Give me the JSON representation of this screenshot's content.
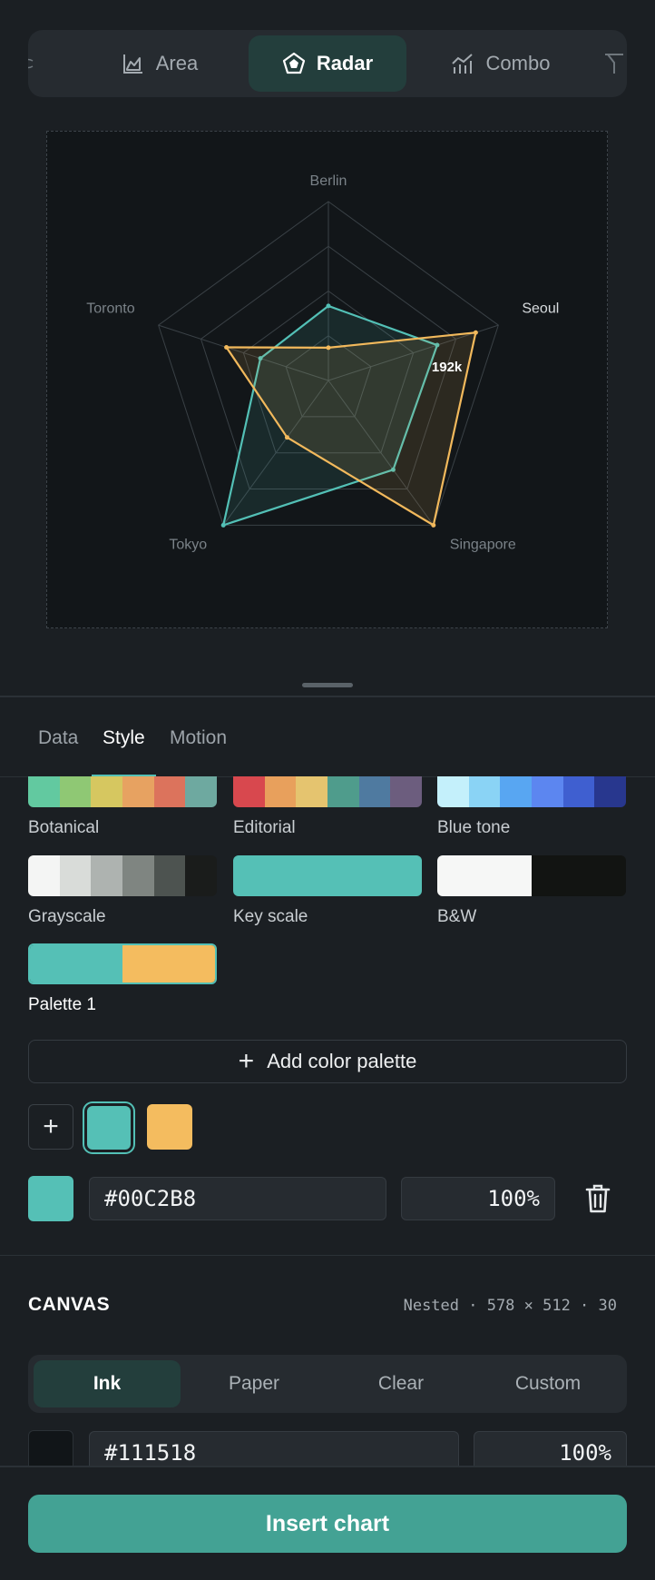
{
  "chart_types": [
    {
      "label": "Area",
      "icon": "area-chart-icon",
      "active": false
    },
    {
      "label": "Radar",
      "icon": "radar-chart-icon",
      "active": true
    },
    {
      "label": "Combo",
      "icon": "combo-chart-icon",
      "active": false
    }
  ],
  "chart_data": {
    "type": "radar",
    "categories": [
      "Berlin",
      "Seoul",
      "Singapore",
      "Tokyo",
      "Toronto"
    ],
    "value_max": 300,
    "series": [
      {
        "color": "#53c0b6",
        "values": [
          125,
          192,
          185,
          300,
          120
        ]
      },
      {
        "color": "#f2b95c",
        "values": [
          55,
          260,
          300,
          118,
          180
        ]
      }
    ],
    "annotation": {
      "label": "192k",
      "category": "Seoul"
    }
  },
  "panel_tabs": [
    {
      "label": "Data",
      "active": false
    },
    {
      "label": "Style",
      "active": true
    },
    {
      "label": "Motion",
      "active": false
    }
  ],
  "palettes": [
    {
      "name": "Botanical",
      "colors": [
        "#62c9a0",
        "#8fc874",
        "#d6c760",
        "#e7a261",
        "#dc735c",
        "#6ea9a0"
      ]
    },
    {
      "name": "Editorial",
      "colors": [
        "#d8484e",
        "#e8a05c",
        "#e5c46f",
        "#4f9c8c",
        "#4f7aa0",
        "#6c5d7e"
      ]
    },
    {
      "name": "Blue tone",
      "colors": [
        "#c4f0fb",
        "#8ad3f5",
        "#58a6f2",
        "#5c86f0",
        "#3f5fd0",
        "#28378e"
      ]
    },
    {
      "name": "Grayscale",
      "colors": [
        "#f4f5f4",
        "#d9dcd9",
        "#aeb3b0",
        "#7f8581",
        "#4d5350",
        "#1a1c1b"
      ]
    },
    {
      "name": "Key scale",
      "colors": [
        "#55c0b6"
      ]
    },
    {
      "name": "B&W",
      "colors": [
        "#f6f7f6",
        "#121412"
      ]
    },
    {
      "name": "Palette 1",
      "colors": [
        "#55c0b6",
        "#f4bc5f"
      ],
      "selected": true
    }
  ],
  "add_palette_label": "Add color palette",
  "palette_colors": [
    "#55c0b6",
    "#f4bc5f"
  ],
  "color_editor": {
    "swatch": "#55c0b6",
    "hex": "#00C2B8",
    "opacity": "100%"
  },
  "canvas": {
    "title": "CANVAS",
    "meta": "Nested · 578 × 512 · 30",
    "options": [
      {
        "label": "Ink",
        "active": true
      },
      {
        "label": "Paper",
        "active": false
      },
      {
        "label": "Clear",
        "active": false
      },
      {
        "label": "Custom",
        "active": false
      }
    ],
    "swatch": "#111518",
    "hex": "#111518",
    "opacity": "100%"
  },
  "insert_label": "Insert chart"
}
